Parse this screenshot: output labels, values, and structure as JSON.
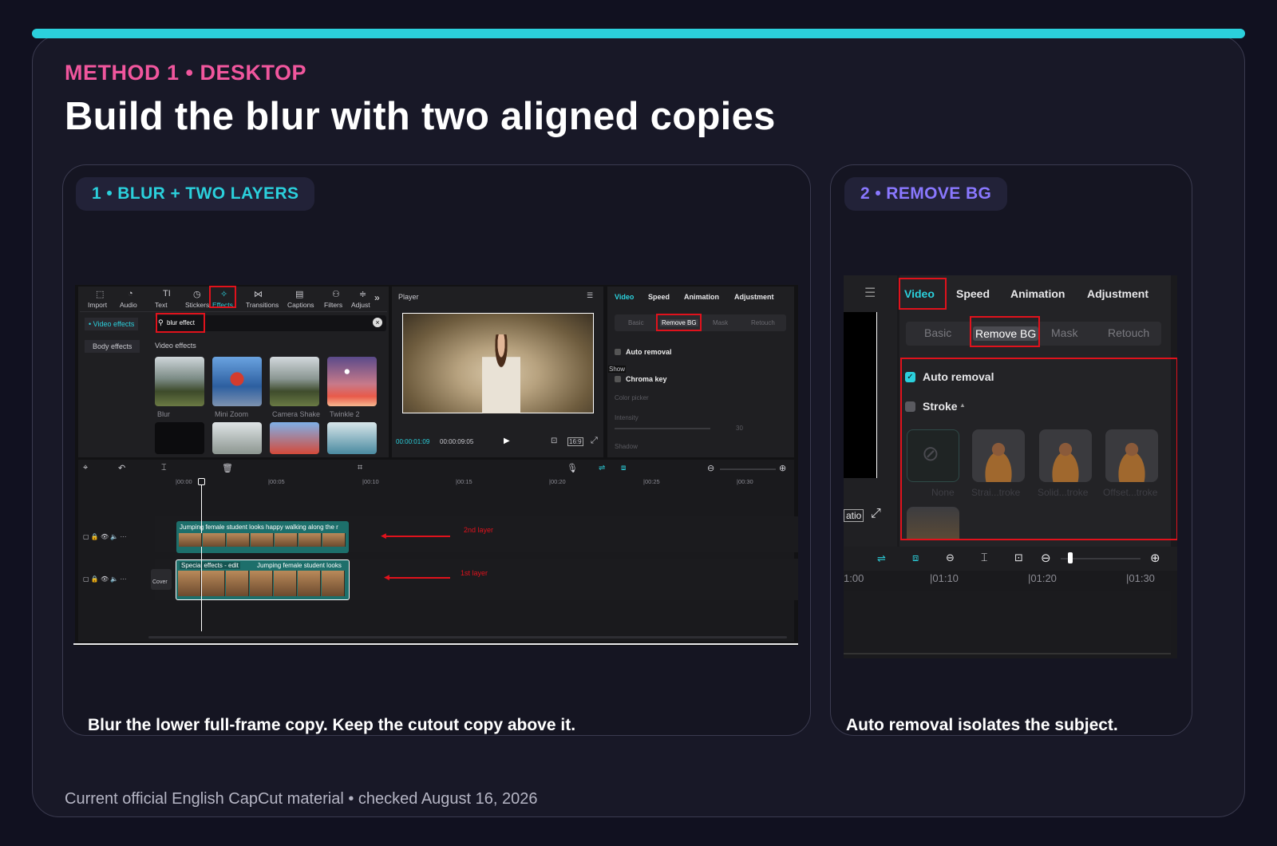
{
  "header": {
    "eyebrow": "METHOD 1 • DESKTOP",
    "title": "Build the blur with two aligned copies"
  },
  "footer": "Current official English CapCut material • checked August 16, 2026",
  "colors": {
    "accent_cyan": "#2bd0dc",
    "accent_pink": "#f0569d",
    "accent_purple": "#7c6cf6",
    "highlight_red": "#e0121c",
    "editor_teal": "#1fb9c4"
  },
  "card1": {
    "pill": "1 • BLUR + TWO LAYERS",
    "caption": "Blur the lower full-frame copy. Keep the cutout copy above it.",
    "toolbar": [
      {
        "label": "Import",
        "icon": "import-icon"
      },
      {
        "label": "Audio",
        "icon": "audio-icon"
      },
      {
        "label": "Text",
        "icon": "text-icon"
      },
      {
        "label": "Stickers",
        "icon": "stickers-icon"
      },
      {
        "label": "Effects",
        "icon": "effects-icon"
      },
      {
        "label": "Transitions",
        "icon": "transitions-icon"
      },
      {
        "label": "Captions",
        "icon": "captions-icon"
      },
      {
        "label": "Filters",
        "icon": "filters-icon"
      },
      {
        "label": "Adjust",
        "icon": "adjust-icon"
      }
    ],
    "side": [
      "• Video effects",
      "Body effects"
    ],
    "search_value": "blur effect",
    "section": "Video effects",
    "effects": [
      "Blur",
      "Mini Zoom",
      "Camera Shake",
      "Twinkle 2"
    ],
    "player": {
      "title": "Player",
      "time_current": "00:00:01:09",
      "time_total": "00:00:09:05",
      "ratio": "16:9"
    },
    "inspector": {
      "tabs": [
        "Video",
        "Speed",
        "Animation",
        "Adjustment"
      ],
      "subtabs": [
        "Basic",
        "Remove BG",
        "Mask",
        "Retouch"
      ],
      "auto_removal": "Auto removal",
      "show": "Show",
      "chroma": "Chroma key",
      "color_picker": "Color picker",
      "intensity": "Intensity",
      "intensity_value": "30",
      "shadow": "Shadow"
    },
    "ruler": [
      "|00:00",
      "|00:05",
      "|00:10",
      "|00:15",
      "|00:20",
      "|00:25",
      "|00:30"
    ],
    "clips": {
      "top": "Jumping female student looks happy walking along the r",
      "bottom_tag": "Special effects - edit",
      "bottom": "Jumping female student looks"
    },
    "annotations": {
      "layer2": "2nd layer",
      "layer1": "1st layer"
    },
    "cover": "Cover"
  },
  "card2": {
    "pill": "2 • REMOVE BG",
    "caption": "Auto removal isolates the subject.",
    "tabs": [
      "Video",
      "Speed",
      "Animation",
      "Adjustment"
    ],
    "subtabs": [
      "Basic",
      "Remove BG",
      "Mask",
      "Retouch"
    ],
    "auto_removal": "Auto removal",
    "stroke": "Stroke",
    "stroke_options": [
      "None",
      "Strai...troke",
      "Solid...troke",
      "Offset...troke"
    ],
    "ratio": "atio",
    "ruler": [
      "1:00",
      "|01:10",
      "|01:20",
      "|01:30"
    ]
  }
}
